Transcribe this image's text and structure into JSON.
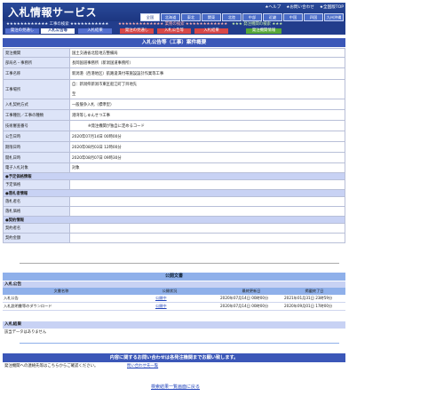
{
  "header": {
    "logo": "入札情報サービス",
    "links": [
      "★ヘルプ",
      "★お問い合わせ",
      "★全国版TOP"
    ],
    "regions": [
      "全国",
      "北海道",
      "東北",
      "関東",
      "北陸",
      "中部",
      "近畿",
      "中国",
      "四国",
      "九州沖縄"
    ],
    "selected_region": "全国"
  },
  "searchbar": {
    "construction": "★★★★★★★★★★★★ 工事の検索 ★★★★★★★★★★★",
    "services": "★★★★★★★★★★★★★ 業務の検索 ★★★★★★★★★★★★",
    "orgs": "★★★ 発注機関の検索 ★★★"
  },
  "tabs": [
    {
      "label": "発注の見通し",
      "color": "blue"
    },
    {
      "label": "入札公告等",
      "color": "blue",
      "active": true
    },
    {
      "label": "入札結果",
      "color": "blue"
    },
    {
      "label": "発注の見通し",
      "color": "red"
    },
    {
      "label": "入札公告等",
      "color": "red"
    },
    {
      "label": "入札結果",
      "color": "red"
    },
    {
      "label": "発注機関情報",
      "color": "green"
    }
  ],
  "summary_title": "入札公告等（工事）案件概要",
  "summary": {
    "org": {
      "label": "発注機関",
      "value": "国土交通省北陸地方整備局"
    },
    "office": {
      "label": "部局名・事務所",
      "value": "長岡国道事務所（新潟国道事務所）"
    },
    "name": {
      "label": "工事名称",
      "value": "新潟港（西港地区）航路浚渫付帯施設設計作業等工事"
    },
    "place": {
      "label": "工事場所",
      "value1": "自：新潟県新潟市東区船江町丁目地先",
      "value2": "至"
    },
    "method": {
      "label": "入札契約方式",
      "value": "一般競争入札（標準型）"
    },
    "type": {
      "label": "工事種別／工事の種類",
      "value": "港湾等しゅんせつ工事"
    },
    "cert": {
      "label": "技術審査番号",
      "value": "※発注機関が独自に定めるコード"
    },
    "announce": {
      "label": "公告日時",
      "value": "2020年07月14日 00時00分"
    },
    "deadline": {
      "label": "期限日時",
      "value": "2020年08月03日 12時00分"
    },
    "open": {
      "label": "開札日時",
      "value": "2020年08月07日 09時30分"
    },
    "ebid": {
      "label": "電子入札対象",
      "value": "対象"
    },
    "sec_budget": "●予定価格情報",
    "budget": {
      "label": "予定価格",
      "value": ""
    },
    "sec_winner": "●落札者情報",
    "winner": {
      "label": "落札者名",
      "value": ""
    },
    "amount": {
      "label": "落札価格",
      "value": ""
    },
    "sec_contract": "●契約情報",
    "cname": {
      "label": "契約者名",
      "value": ""
    },
    "camount": {
      "label": "契約金額",
      "value": ""
    }
  },
  "public_docs": {
    "title": "公開文書",
    "sub1": "入札公告",
    "columns": [
      "文書名称",
      "公開状況",
      "最終更新日",
      "掲載終了日"
    ],
    "rows": [
      {
        "name": "入札公告",
        "status": "公開中",
        "updated": "2020年07月14日 00時00分",
        "end": "2021年01月31日 23時59分"
      },
      {
        "name": "入札説明書等のダウンロード",
        "status": "公開中",
        "updated": "2020年07月14日 00時00分",
        "end": "2020年09月01日 17時00分"
      }
    ],
    "sub2": "入札結果",
    "none": "該当データはありません"
  },
  "contact": {
    "title": "内容に関するお問い合わせは各発注機関までお願い致します。",
    "text": "発注機関への連絡先等はこちらからご確認ください。",
    "link": "問い合わせ先一覧"
  },
  "back": "検索結果一覧画面に戻る"
}
